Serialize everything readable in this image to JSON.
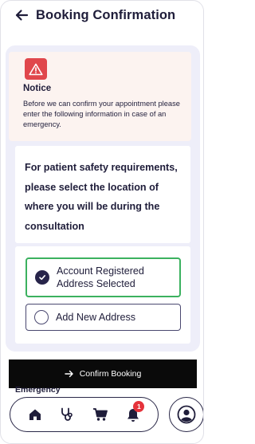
{
  "header": {
    "title": "Booking Confirmation",
    "back_icon": "arrow-left-icon"
  },
  "notice": {
    "icon": "warning-triangle-icon",
    "title": "Notice",
    "body": "Before we can confirm your appointment please enter the following information in case of an emergency."
  },
  "safety": {
    "text": "For patient safety requirements, please select the location of where you will be during the consultation"
  },
  "address_options": [
    {
      "label": "Account Registered Address Selected",
      "selected": true
    },
    {
      "label": "Add New Address",
      "selected": false
    }
  ],
  "confirm_button": {
    "label": "Confirm Booking",
    "icon": "arrow-right-icon"
  },
  "next_section_peek": "Emergency",
  "bottom_nav": {
    "items": [
      {
        "name": "home",
        "icon": "home-icon"
      },
      {
        "name": "consultations",
        "icon": "stethoscope-icon"
      },
      {
        "name": "cart",
        "icon": "cart-icon"
      },
      {
        "name": "notifications",
        "icon": "bell-icon",
        "badge": "1"
      }
    ],
    "profile_icon": "user-circle-icon"
  },
  "colors": {
    "primary_dark": "#1f1d3a",
    "content_bg": "#eeeef9",
    "notice_bg": "#fcf3f0",
    "warning_red": "#e0474c",
    "selected_green": "#3bb15f",
    "button_black": "#0a0a0a",
    "badge_red": "#e5333b"
  }
}
